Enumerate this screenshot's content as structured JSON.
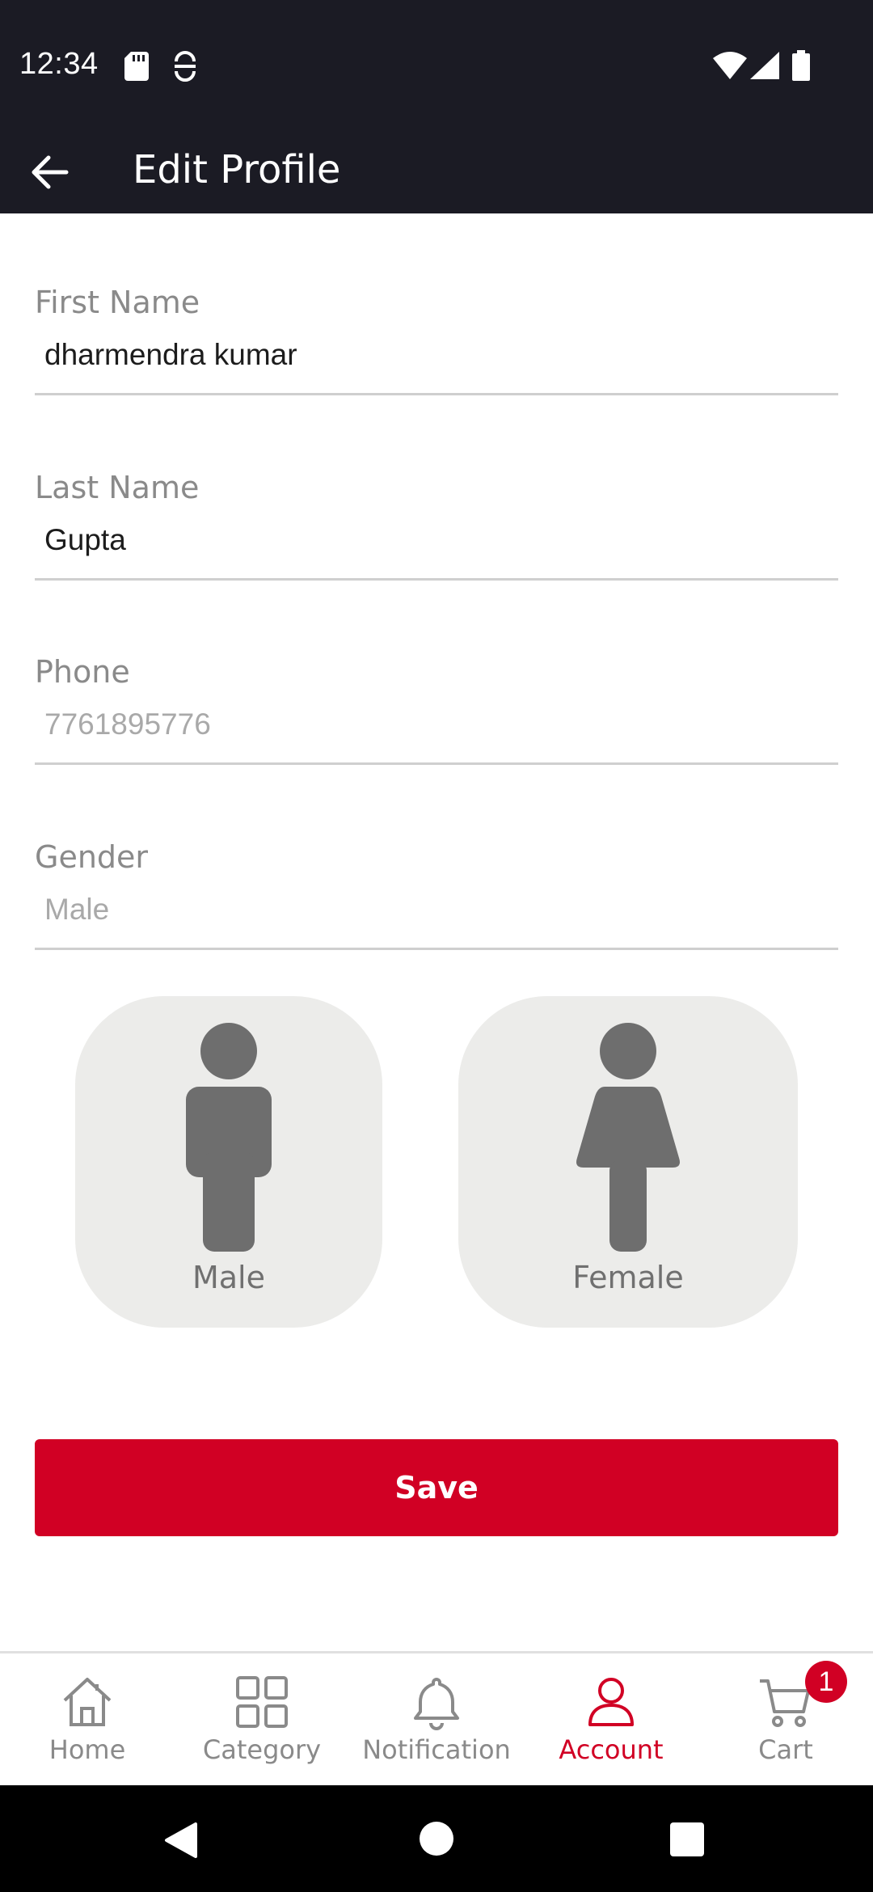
{
  "status_bar": {
    "time": "12:34",
    "icons": [
      "sd-card-icon",
      "sync-icon",
      "wifi-icon",
      "signal-icon",
      "battery-icon"
    ]
  },
  "app_bar": {
    "title": "Edit Profile",
    "back_icon": "arrow-left-icon"
  },
  "form": {
    "first_name": {
      "label": "First Name",
      "value": "dharmendra kumar"
    },
    "last_name": {
      "label": "Last Name",
      "value": "Gupta"
    },
    "phone": {
      "label": "Phone",
      "value": "7761895776"
    },
    "gender": {
      "label": "Gender",
      "value": "Male"
    }
  },
  "gender_options": [
    {
      "label": "Male",
      "icon": "male-figure-icon"
    },
    {
      "label": "Female",
      "icon": "female-figure-icon"
    }
  ],
  "save_label": "Save",
  "bottom_nav": {
    "items": [
      {
        "label": "Home",
        "icon": "home-icon"
      },
      {
        "label": "Category",
        "icon": "grid-icon"
      },
      {
        "label": "Notification",
        "icon": "bell-icon"
      },
      {
        "label": "Account",
        "icon": "user-icon",
        "active": true
      },
      {
        "label": "Cart",
        "icon": "cart-icon"
      }
    ],
    "cart_badge": "1"
  },
  "colors": {
    "header_bg": "#1b1b24",
    "accent": "#d10024",
    "card_bg": "#ececea",
    "figure": "#6e6e6e"
  }
}
